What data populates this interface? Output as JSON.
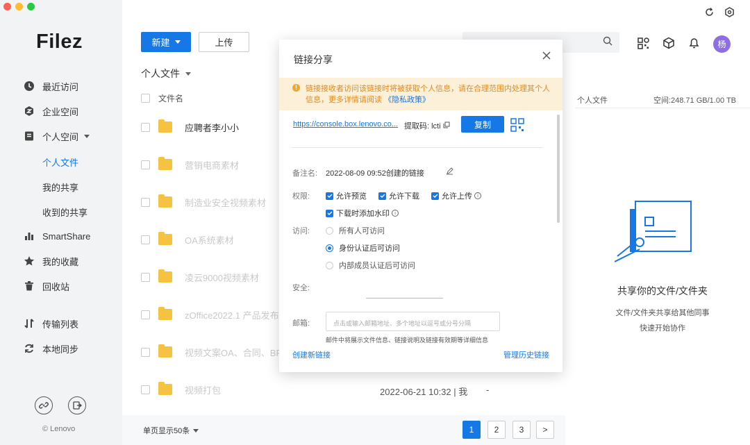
{
  "sidebar": {
    "logo": "Filez",
    "items": [
      {
        "label": "最近访问",
        "icon": "clock-icon"
      },
      {
        "label": "企业空间",
        "icon": "enterprise-icon"
      },
      {
        "label": "个人空间",
        "icon": "personal-space-icon"
      },
      {
        "label": "SmartShare",
        "icon": "bar-chart-icon"
      },
      {
        "label": "我的收藏",
        "icon": "star-icon"
      },
      {
        "label": "回收站",
        "icon": "trash-icon"
      },
      {
        "label": "传输列表",
        "icon": "transfer-icon"
      },
      {
        "label": "本地同步",
        "icon": "sync-icon"
      }
    ],
    "sub_items": [
      "个人文件",
      "我的共享",
      "收到的共享"
    ],
    "active_sub": "个人文件",
    "copyright": "© Lenovo"
  },
  "toolbar": {
    "new_label": "新建",
    "upload_label": "上传"
  },
  "breadcrumb": "个人文件",
  "list": {
    "header_name": "文件名",
    "rows": [
      {
        "name": "应聘者李小小"
      },
      {
        "name": "营销电商素材"
      },
      {
        "name": "制造业安全视频素材"
      },
      {
        "name": "OA系统素材"
      },
      {
        "name": "凌云9000视频素材"
      },
      {
        "name": "zOffice2022.1 产品发布"
      },
      {
        "name": "视频文案OA、合同、BPM"
      },
      {
        "name": "视频打包"
      }
    ],
    "last_row_date": "2022-06-21 10:32 | 我",
    "last_row_size": "-"
  },
  "right_panel": {
    "location": "个人文件",
    "space": "空间:248.71 GB/1.00 TB",
    "title": "共享你的文件/文件夹",
    "desc_line1": "文件/文件夹共享给其他同事",
    "desc_line2": "快速开始协作"
  },
  "header": {
    "avatar_text": "杨"
  },
  "pagination": {
    "page_size": "单页显示50条",
    "pages": [
      "1",
      "2",
      "3"
    ],
    "current": "1",
    "next": ">"
  },
  "modal": {
    "title": "链接分享",
    "warning_text": "链接接收者访问该链接时将被获取个人信息，请在合理范围内处理其个人信息，更多详情请阅读",
    "warning_link": "《隐私政策》",
    "url": "https://console.box.lenovo.co...",
    "code": "提取码: lcti",
    "copy_label": "复制",
    "remark_label": "备注名:",
    "remark_value": "2022-08-09 09:52创建的链接",
    "permission_label": "权限:",
    "permissions": [
      "允许预览",
      "允许下载",
      "允许上传",
      "下载时添加水印"
    ],
    "access_label": "访问:",
    "access_options": [
      "所有人可访问",
      "身份认证后可访问",
      "内部成员认证后可访问"
    ],
    "access_selected": 1,
    "security_label": "安全:",
    "email_label": "邮箱:",
    "email_placeholder": "点击或输入邮箱地址、多个地址以逗号或分号分隔",
    "email_hint": "邮件中将展示文件信息、链接说明及链接有效期等详细信息",
    "create_link": "创建新链接",
    "manage_link": "管理历史链接"
  },
  "colors": {
    "accent": "#1677e6",
    "warning_bg": "#fdf0d9",
    "warning_text": "#e08a1e",
    "folder": "#f5c242",
    "avatar": "#8e6ee6"
  }
}
